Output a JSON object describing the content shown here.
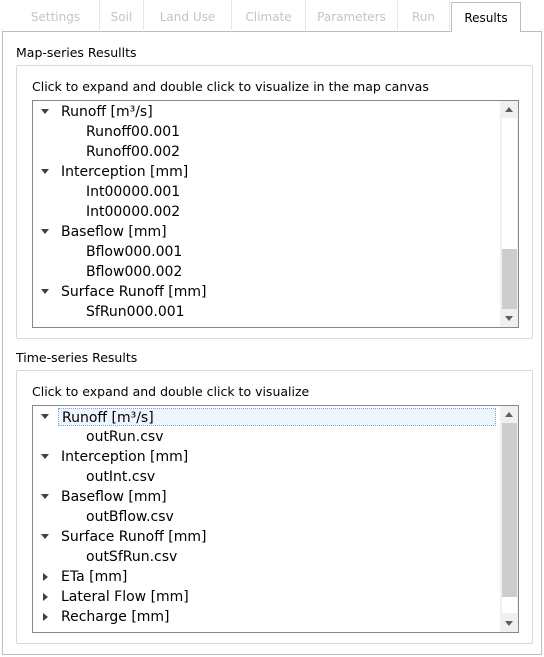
{
  "tabs": [
    {
      "label": "Settings",
      "active": false
    },
    {
      "label": "Soil",
      "active": false
    },
    {
      "label": "Land Use",
      "active": false
    },
    {
      "label": "Climate",
      "active": false
    },
    {
      "label": "Parameters",
      "active": false
    },
    {
      "label": "Run",
      "active": false
    },
    {
      "label": "Results",
      "active": true
    }
  ],
  "map_series": {
    "title": "Map-series Resullts",
    "caption": "Click to expand and double click to visualize in the map canvas",
    "items": [
      {
        "label": "Runoff [m³/s]",
        "level": 0,
        "expanded": true
      },
      {
        "label": "Runoff00.001",
        "level": 1
      },
      {
        "label": "Runoff00.002",
        "level": 1
      },
      {
        "label": "Interception [mm]",
        "level": 0,
        "expanded": true
      },
      {
        "label": "Int00000.001",
        "level": 1
      },
      {
        "label": "Int00000.002",
        "level": 1
      },
      {
        "label": "Baseflow [mm]",
        "level": 0,
        "expanded": true
      },
      {
        "label": "Bflow000.001",
        "level": 1
      },
      {
        "label": "Bflow000.002",
        "level": 1
      },
      {
        "label": "Surface Runoff [mm]",
        "level": 0,
        "expanded": true
      },
      {
        "label": "SfRun000.001",
        "level": 1
      }
    ]
  },
  "time_series": {
    "title": "Time-series Results",
    "caption": "Click to expand and double click to visualize",
    "items": [
      {
        "label": "Runoff [m³/s]",
        "level": 0,
        "expanded": true,
        "selected": true
      },
      {
        "label": "outRun.csv",
        "level": 1
      },
      {
        "label": "Interception [mm]",
        "level": 0,
        "expanded": true
      },
      {
        "label": "outInt.csv",
        "level": 1
      },
      {
        "label": "Baseflow [mm]",
        "level": 0,
        "expanded": true
      },
      {
        "label": "outBflow.csv",
        "level": 1
      },
      {
        "label": "Surface Runoff [mm]",
        "level": 0,
        "expanded": true
      },
      {
        "label": "outSfRun.csv",
        "level": 1
      },
      {
        "label": "ETa [mm]",
        "level": 0,
        "expanded": false
      },
      {
        "label": "Lateral Flow [mm]",
        "level": 0,
        "expanded": false
      },
      {
        "label": "Recharge [mm]",
        "level": 0,
        "expanded": false
      }
    ]
  },
  "icons": {
    "expanded": "chevron-down-icon",
    "collapsed": "chevron-right-icon",
    "scroll_up": "scroll-up-icon",
    "scroll_down": "scroll-down-icon"
  },
  "colors": {
    "tree_border": "#828790",
    "selection": "#eef5fd",
    "inactive_tab_text": "#c4c4c4"
  }
}
